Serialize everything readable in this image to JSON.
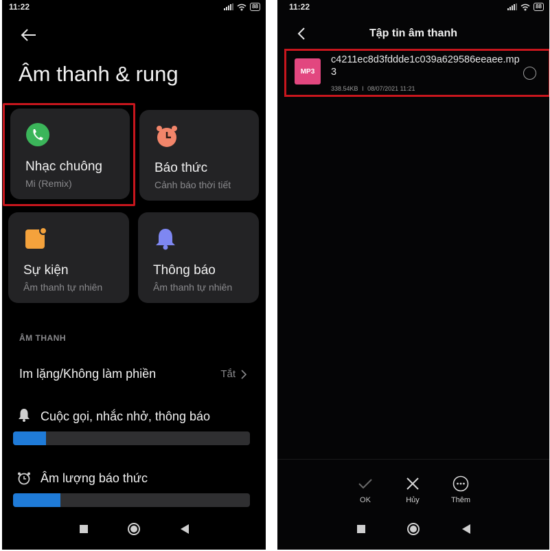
{
  "left_screen": {
    "status": {
      "time": "11:22",
      "battery": "88"
    },
    "page_title": "Âm thanh & rung",
    "cards": [
      {
        "title": "Nhạc chuông",
        "subtitle": "Mi (Remix)",
        "icon": "phone-icon",
        "color": "#3bb55a"
      },
      {
        "title": "Báo thức",
        "subtitle": "Cảnh báo thời tiết",
        "icon": "alarm-clock-icon",
        "color": "#f2856a"
      },
      {
        "title": "Sự kiện",
        "subtitle": "Âm thanh tự nhiên",
        "icon": "calendar-event-icon",
        "color": "#f4a23c"
      },
      {
        "title": "Thông báo",
        "subtitle": "Âm thanh tự nhiên",
        "icon": "bell-icon",
        "color": "#7e87f2"
      }
    ],
    "section_label": "ÂM THANH",
    "dnd_row": {
      "title": "Im lặng/Không làm phiền",
      "value": "Tắt"
    },
    "volumes": [
      {
        "label": "Cuộc gọi, nhắc nhở, thông báo",
        "icon": "bell-icon",
        "level": 0.14
      },
      {
        "label": "Âm lượng báo thức",
        "icon": "alarm-clock-icon",
        "level": 0.2
      }
    ],
    "accent": "#1f7bd8",
    "highlight": "#c8161d"
  },
  "right_screen": {
    "status": {
      "time": "11:22",
      "battery": "88"
    },
    "title": "Tập tin âm thanh",
    "file": {
      "badge": "MP3",
      "name": "c4211ec8d3fddde1c039a629586eeaee.mp3",
      "size": "338.54KB",
      "separator": "I",
      "date": "08/07/2021 11:21"
    },
    "actions": [
      {
        "label": "OK",
        "icon": "check-icon"
      },
      {
        "label": "Hủy",
        "icon": "close-icon"
      },
      {
        "label": "Thêm",
        "icon": "more-icon"
      }
    ]
  }
}
